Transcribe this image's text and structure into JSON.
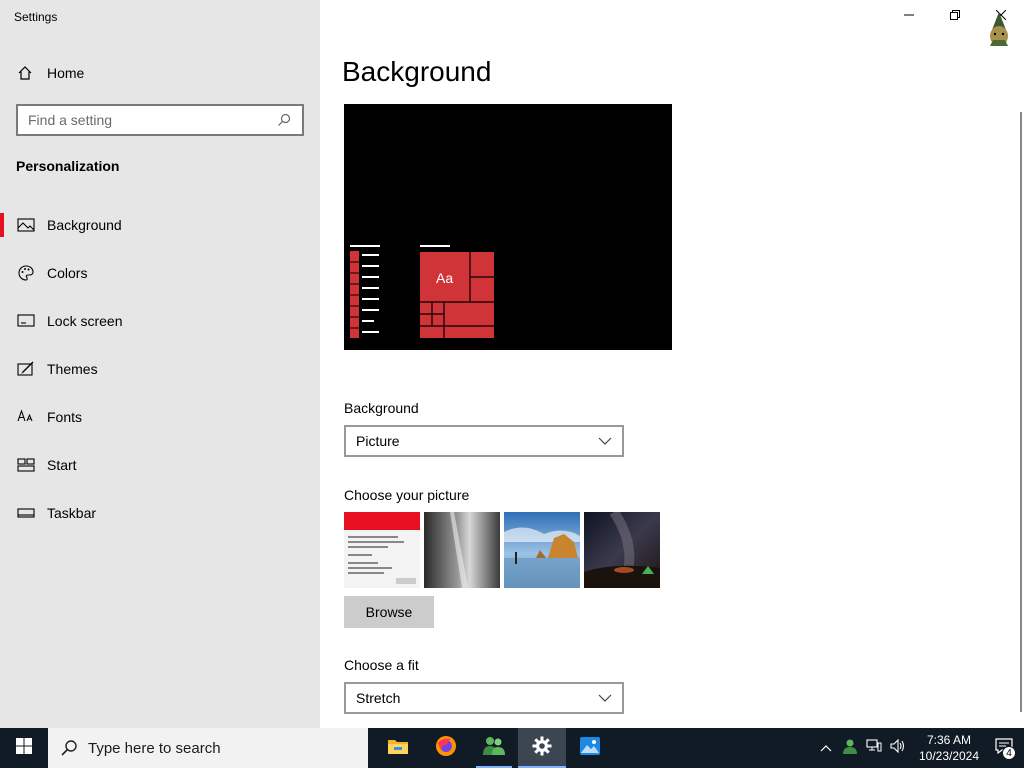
{
  "app": {
    "title": "Settings"
  },
  "sidebar": {
    "home_label": "Home",
    "search_placeholder": "Find a setting",
    "section_title": "Personalization",
    "items": [
      {
        "label": "Background",
        "icon": "picture-icon",
        "active": true
      },
      {
        "label": "Colors",
        "icon": "palette-icon"
      },
      {
        "label": "Lock screen",
        "icon": "lock-screen-icon"
      },
      {
        "label": "Themes",
        "icon": "themes-icon"
      },
      {
        "label": "Fonts",
        "icon": "fonts-icon"
      },
      {
        "label": "Start",
        "icon": "start-icon"
      },
      {
        "label": "Taskbar",
        "icon": "taskbar-icon"
      }
    ]
  },
  "main": {
    "page_title": "Background",
    "preview": {
      "tile_text": "Aa",
      "accent_color": "#d13438"
    },
    "background_label": "Background",
    "background_value": "Picture",
    "choose_picture_label": "Choose your picture",
    "browse_label": "Browse",
    "choose_fit_label": "Choose a fit",
    "fit_value": "Stretch"
  },
  "taskbar": {
    "search_placeholder": "Type here to search",
    "apps": [
      "file-explorer-icon",
      "firefox-icon",
      "people-icon",
      "settings-icon",
      "photos-icon"
    ],
    "clock_time": "7:36 AM",
    "clock_date": "10/23/2024",
    "notification_count": "4"
  },
  "colors": {
    "accent": "#e81123",
    "taskbar": "#101b26",
    "sidebar": "#e6e6e6"
  }
}
